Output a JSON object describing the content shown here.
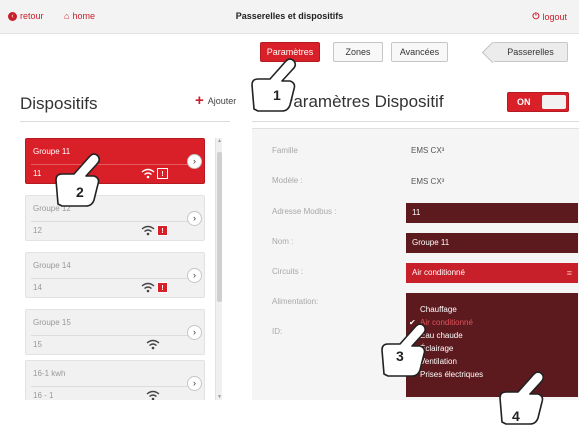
{
  "topbar": {
    "back_label": "retour",
    "home_label": "home",
    "title": "Passerelles et dispositifs",
    "logout_label": "logout"
  },
  "tabs": [
    {
      "label": "Paramètres",
      "active": true
    },
    {
      "label": "Zones",
      "active": false
    },
    {
      "label": "Avancées",
      "active": false
    },
    {
      "label": "Passerelles",
      "active": false
    }
  ],
  "left_panel": {
    "title": "Dispositifs",
    "add_label": "Ajouter",
    "devices": [
      {
        "name": "Groupe 11",
        "sub": "11",
        "active": true,
        "alert": true
      },
      {
        "name": "Groupe 12",
        "sub": "12",
        "active": false,
        "alert": true
      },
      {
        "name": "Groupe 14",
        "sub": "14",
        "active": false,
        "alert": true
      },
      {
        "name": "Groupe 15",
        "sub": "15",
        "active": false,
        "alert": false
      },
      {
        "name": "16-1 kwh",
        "sub": "16 - 1",
        "active": false,
        "alert": false
      }
    ],
    "alert_badge": "!"
  },
  "right_panel": {
    "title": "Paramètres Dispositif",
    "toggle_label": "ON",
    "fields": {
      "famille_label": "Famille",
      "famille_value": "EMS CX³",
      "modele_label": "Modèle :",
      "modele_value": "EMS CX³",
      "adresse_label": "Adresse Modbus :",
      "adresse_value": "11",
      "nom_label": "Nom :",
      "nom_value": "Groupe 11",
      "circuits_label": "Circuits :",
      "circuits_value": "Air conditionné",
      "alimentation_label": "Alimentation:",
      "id_label": "ID:"
    },
    "circuit_options": [
      {
        "label": "Chauffage",
        "selected": false
      },
      {
        "label": "Air conditionné",
        "selected": true
      },
      {
        "label": "Eau chaude",
        "selected": false
      },
      {
        "label": "Éclairage",
        "selected": false
      },
      {
        "label": "Ventilation",
        "selected": false
      },
      {
        "label": "Prises électriques",
        "selected": false
      }
    ]
  },
  "callouts": [
    "1",
    "2",
    "3",
    "4"
  ],
  "colors": {
    "accent": "#d91f27",
    "dark_field": "#5c1a1e"
  }
}
